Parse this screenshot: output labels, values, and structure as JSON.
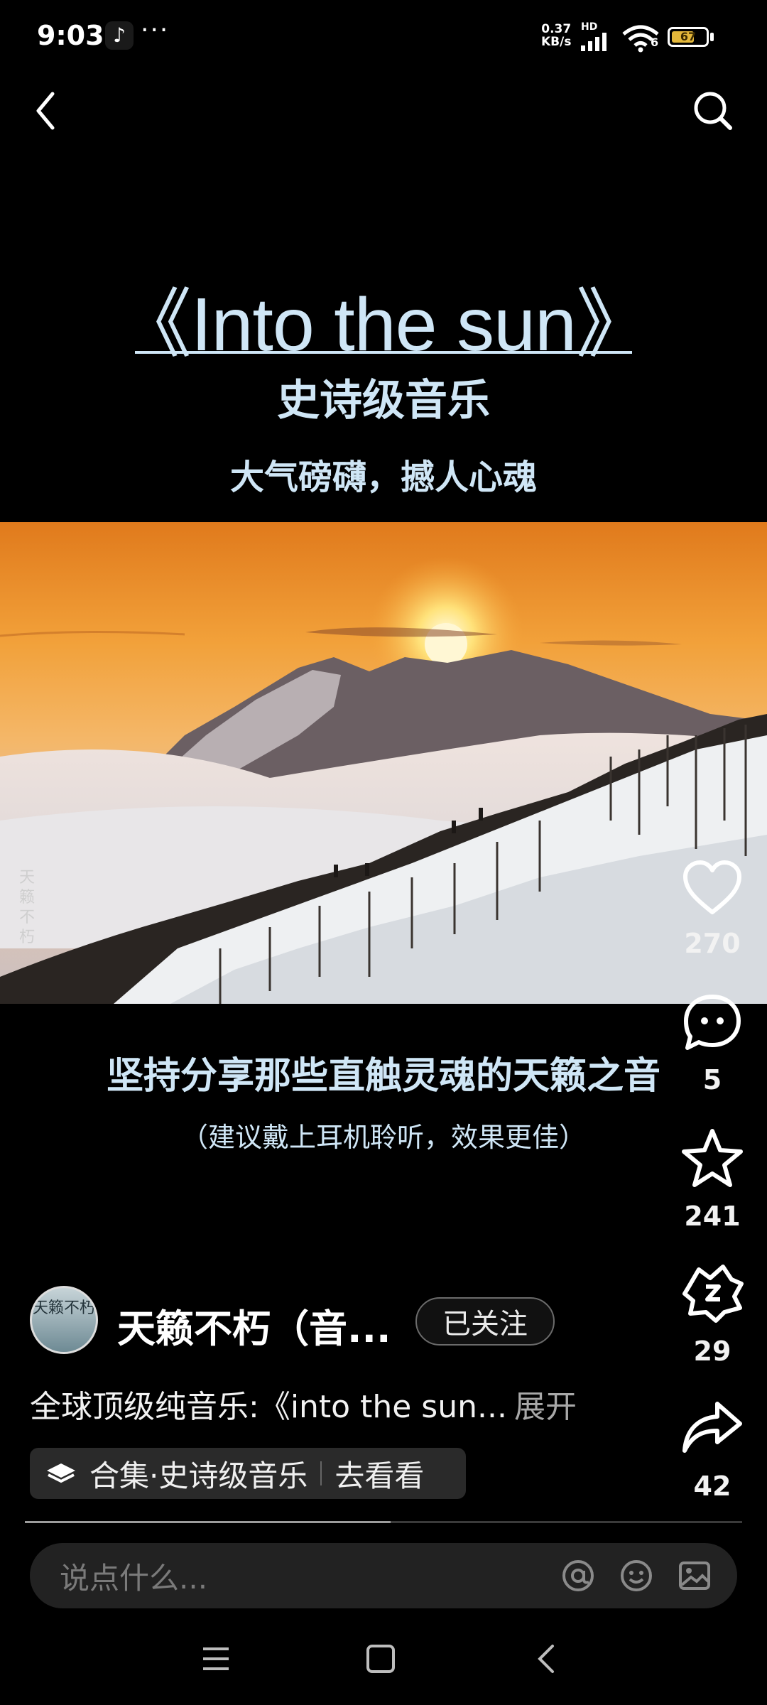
{
  "status_bar": {
    "time": "9:03",
    "app_icon": "tiktok-icon",
    "more": "···",
    "net_speed_value": "0.37",
    "net_speed_unit": "KB/s",
    "net_type": "HD",
    "wifi_badge": "6",
    "battery": "67",
    "battery_level": 0.67
  },
  "nav": {
    "back_icon": "back-arrow-icon",
    "search_icon": "search-icon"
  },
  "video": {
    "title": "《Into the sun》",
    "subtitle": "史诗级音乐",
    "tagline": "大气磅礴，撼人心魂",
    "watermark": "天籁不朽",
    "caption_main": "坚持分享那些直触灵魂的天籁之音",
    "caption_sub": "（建议戴上耳机聆听，效果更佳）",
    "progress": 0.51
  },
  "actions": {
    "like_count": "270",
    "comment_count": "5",
    "favorite_count": "241",
    "reward_count": "29",
    "share_count": "42"
  },
  "author": {
    "avatar_text": "天籁不朽",
    "name": "天籁不朽（音...",
    "follow_label": "已关注"
  },
  "description": {
    "text": "全球顶级纯音乐:《into the sun...",
    "expand": "展开"
  },
  "collection": {
    "label": "合集·史诗级音乐",
    "action": "去看看"
  },
  "comment_bar": {
    "placeholder": "说点什么..."
  },
  "colors": {
    "title": "#cfe6f6",
    "battery": "#e3b73a"
  }
}
